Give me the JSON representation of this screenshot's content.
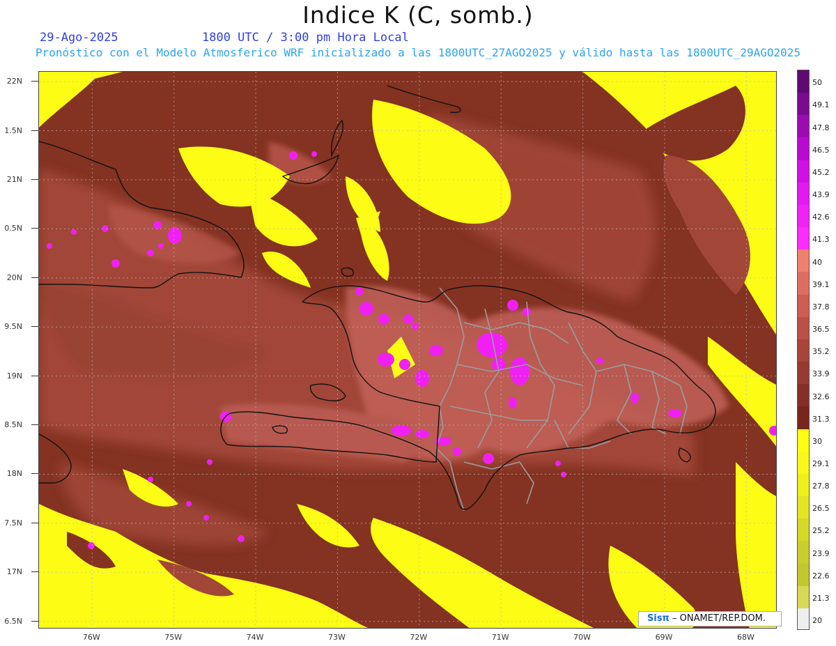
{
  "header": {
    "title": "Indice K (C, somb.)",
    "date": "29-Ago-2025",
    "valid_time": "1800 UTC / 3:00 pm Hora Local",
    "description": "Pronóstico con el Modelo Atmosferico WRF inicializado a las 1800UTC_27AGO2025 y válido hasta las  1800UTC_29AGO2025"
  },
  "axes": {
    "lat_labels": [
      "22N",
      "1.5N",
      "21N",
      "0.5N",
      "20N",
      "9.5N",
      "19N",
      "8.5N",
      "18N",
      "7.5N",
      "17N",
      "6.5N"
    ],
    "lat_values": [
      22,
      21.5,
      21,
      20.5,
      20,
      19.5,
      19,
      18.5,
      18,
      17.5,
      17,
      16.5
    ],
    "lon_labels": [
      "76W",
      "75W",
      "74W",
      "73W",
      "72W",
      "71W",
      "70W",
      "69W",
      "68W"
    ],
    "lon_values": [
      -76,
      -75,
      -74,
      -73,
      -72,
      -71,
      -70,
      -69,
      -68
    ],
    "lon_range": [
      -76.65,
      -67.62
    ],
    "lat_range": [
      16.42,
      22.1
    ]
  },
  "colorbar": {
    "labels": [
      "50",
      "49.1",
      "47.8",
      "46.5",
      "45.2",
      "43.9",
      "42.6",
      "41.3",
      "40",
      "39.1",
      "37.8",
      "36.5",
      "35.2",
      "33.9",
      "32.6",
      "31.3",
      "30",
      "29.1",
      "27.8",
      "26.5",
      "25.2",
      "23.9",
      "22.6",
      "21.3",
      "20"
    ],
    "colors": [
      "#5e0a72",
      "#7a0a90",
      "#9b0bb2",
      "#b80bcf",
      "#d010e4",
      "#e21af0",
      "#f022f6",
      "#fa2dfc",
      "#f08070",
      "#de6e62",
      "#cc5e54",
      "#ba5048",
      "#a8443c",
      "#973a31",
      "#872f26",
      "#78261d",
      "#fefe14",
      "#f8f81a",
      "#eef01e",
      "#e2e424",
      "#d6d828",
      "#cace2e",
      "#c2c630",
      "#d8d858",
      "#eeeeee"
    ]
  },
  "map": {
    "colors": {
      "ocean_base": "#843222",
      "mid": "#a44a3a",
      "light": "#c0625a",
      "yellow": "#fcfc14",
      "magenta": "#f020f4",
      "border": "#999999",
      "coast": "#111111"
    }
  },
  "credit": {
    "logo": "Sisπ",
    "text": " – ONAMET/REP.DOM."
  }
}
